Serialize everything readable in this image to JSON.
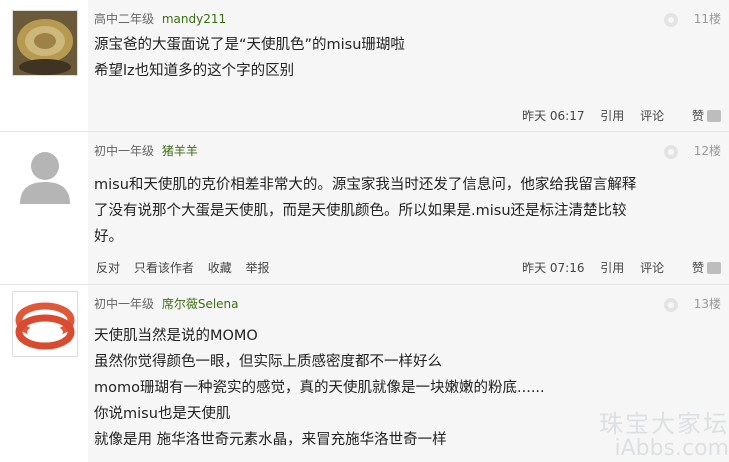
{
  "posts": [
    {
      "level": "高中二年级",
      "username": "mandy211",
      "floor": "11楼",
      "lines": [
        "源宝爸的大蛋面说了是“天使肌色”的misu珊瑚啦",
        "希望lz也知道多的这个字的区别"
      ],
      "time": "昨天 06:17",
      "reply": "引用",
      "comment": "评论",
      "like": "赞",
      "avatar_icon": "gold-plate-photo"
    },
    {
      "level": "初中一年级",
      "username": "猪羊羊",
      "floor": "12楼",
      "lines": [
        "misu和天使肌的克价相差非常大的。源宝家我当时还发了信息问，他家给我留言解释",
        "了没有说那个大蛋是天使肌，而是天使肌颜色。所以如果是.misu还是标注清楚比较",
        "好。"
      ],
      "left_actions": [
        "反对",
        "只看该作者",
        "收藏",
        "举报"
      ],
      "time": "昨天 07:16",
      "reply": "引用",
      "comment": "评论",
      "like": "赞",
      "avatar_icon": "default-user-silhouette"
    },
    {
      "level": "初中一年级",
      "username": "席尔薇Selena",
      "floor": "13楼",
      "lines": [
        "天使肌当然是说的MOMO",
        "虽然你觉得颜色一眼，但实际上质感密度都不一样好么",
        "momo珊瑚有一种瓷实的感觉，真的天使肌就像是一块嫩嫩的粉底......",
        "你说misu也是天使肌",
        "就像是用 施华洛世奇元素水晶，来冒充施华洛世奇一样"
      ],
      "avatar_icon": "coral-bead-bracelet-photo"
    }
  ],
  "watermark": {
    "line1": "珠宝大家坛",
    "line2": "iAbbs.com"
  },
  "colors": {
    "username": "#3a6e13",
    "panel_bg": "#f6f6f6"
  }
}
